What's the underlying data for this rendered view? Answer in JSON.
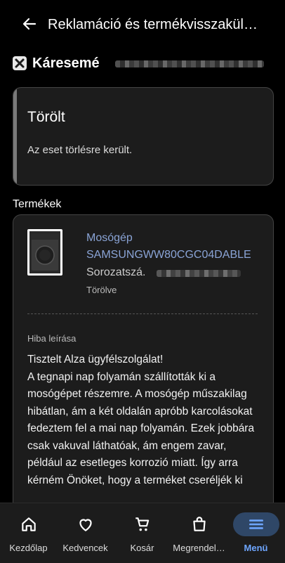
{
  "header": {
    "title": "Reklamáció és termékvisszakül…",
    "back_icon": "arrow-left-icon"
  },
  "case": {
    "icon": "tools-icon",
    "title_prefix": "Káresemé"
  },
  "status": {
    "title": "Törölt",
    "text": "Az eset törlésre került."
  },
  "products": {
    "section_label": "Termékek",
    "items": [
      {
        "category": "Mosógép",
        "model": "SAMSUNGWW80CGC04DABLE",
        "serial_label": "Sorozatszá.",
        "status": "Törölve",
        "error_label": "Hiba leírása",
        "error_text": "Tisztelt Alza ügyfélszolgálat!\nA tegnapi nap folyamán szállították ki a mosógépet részemre. A mosógép műszakilag hibátlan, ám a két oldalán apróbb karcolásokat fedeztem fel a mai nap folyamán. Ezek jobbára csak vakuval láthatóak, ám engem zavar, például az esetleges korrozió miatt. Így arra kérném Önöket, hogy a terméket cseréljék ki"
      }
    ]
  },
  "nav": {
    "items": [
      {
        "label": "Kezdőlap",
        "icon": "home-icon",
        "active": false
      },
      {
        "label": "Kedvencek",
        "icon": "heart-icon",
        "active": false
      },
      {
        "label": "Kosár",
        "icon": "cart-icon",
        "active": false
      },
      {
        "label": "Megrendel…",
        "icon": "shopping-bag-icon",
        "active": false
      },
      {
        "label": "Menü",
        "icon": "menu-icon",
        "active": true
      }
    ],
    "active_color": "#6ea6ff"
  }
}
